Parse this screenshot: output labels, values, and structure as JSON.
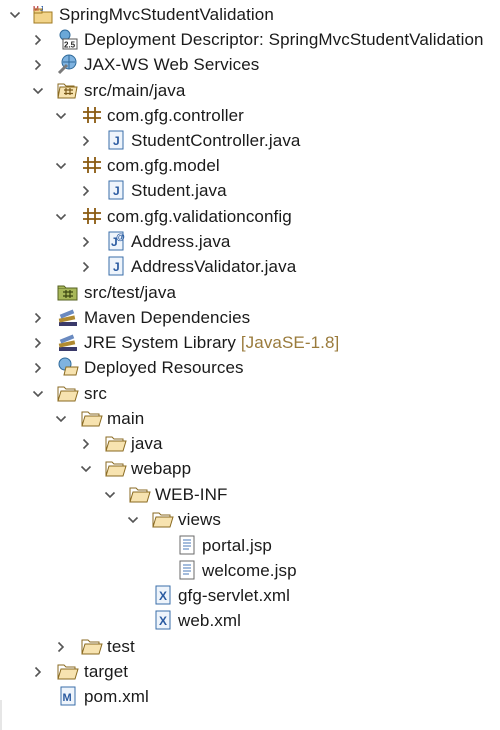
{
  "project_explorer": {
    "items": [
      {
        "label": "SpringMvcStudentValidation",
        "icon": "maven-project-icon",
        "state": "expanded"
      },
      {
        "label": "Deployment Descriptor: SpringMvcStudentValidation",
        "icon": "deployment-descriptor-icon",
        "state": "collapsed"
      },
      {
        "label": "JAX-WS Web Services",
        "icon": "web-services-icon",
        "state": "collapsed"
      },
      {
        "label": "src/main/java",
        "icon": "source-folder-icon",
        "state": "expanded"
      },
      {
        "label": "com.gfg.controller",
        "icon": "package-icon",
        "state": "expanded"
      },
      {
        "label": "StudentController.java",
        "icon": "java-file-icon",
        "state": "collapsed"
      },
      {
        "label": "com.gfg.model",
        "icon": "package-icon",
        "state": "expanded"
      },
      {
        "label": "Student.java",
        "icon": "java-file-icon",
        "state": "collapsed"
      },
      {
        "label": "com.gfg.validationconfig",
        "icon": "package-icon",
        "state": "expanded"
      },
      {
        "label": "Address.java",
        "icon": "java-annotation-icon",
        "state": "collapsed"
      },
      {
        "label": "AddressValidator.java",
        "icon": "java-file-icon",
        "state": "collapsed"
      },
      {
        "label": "src/test/java",
        "icon": "source-folder-icon",
        "state": "leaf"
      },
      {
        "label": "Maven Dependencies",
        "icon": "library-icon",
        "state": "collapsed"
      },
      {
        "label": "JRE System Library",
        "decoration": "[JavaSE-1.8]",
        "icon": "library-icon",
        "state": "collapsed"
      },
      {
        "label": "Deployed Resources",
        "icon": "deployed-resources-icon",
        "state": "collapsed"
      },
      {
        "label": "src",
        "icon": "folder-icon",
        "state": "expanded"
      },
      {
        "label": "main",
        "icon": "folder-icon",
        "state": "expanded"
      },
      {
        "label": "java",
        "icon": "folder-icon",
        "state": "collapsed"
      },
      {
        "label": "webapp",
        "icon": "folder-icon",
        "state": "expanded"
      },
      {
        "label": "WEB-INF",
        "icon": "folder-icon",
        "state": "expanded"
      },
      {
        "label": "views",
        "icon": "folder-icon",
        "state": "expanded"
      },
      {
        "label": "portal.jsp",
        "icon": "jsp-file-icon",
        "state": "leaf"
      },
      {
        "label": "welcome.jsp",
        "icon": "jsp-file-icon",
        "state": "leaf"
      },
      {
        "label": "gfg-servlet.xml",
        "icon": "xml-file-icon",
        "state": "leaf"
      },
      {
        "label": "web.xml",
        "icon": "xml-file-icon",
        "state": "leaf"
      },
      {
        "label": "test",
        "icon": "folder-icon",
        "state": "collapsed"
      },
      {
        "label": "target",
        "icon": "folder-icon",
        "state": "collapsed"
      },
      {
        "label": "pom.xml",
        "icon": "pom-file-icon",
        "state": "leaf"
      }
    ]
  }
}
